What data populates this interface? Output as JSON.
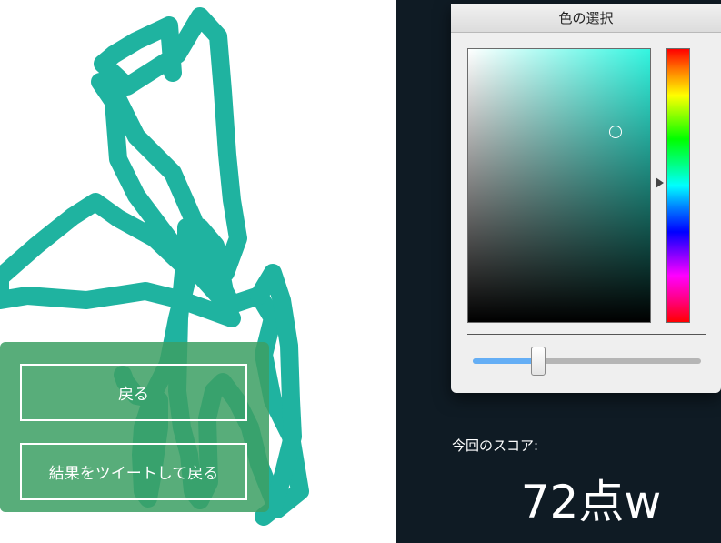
{
  "color_picker": {
    "title": "色の選択",
    "current_color": "#1fb3a0",
    "brightness_fraction": 0.28
  },
  "drawing": {
    "stroke_color": "#1fb3a0"
  },
  "result_panel": {
    "back_label": "戻る",
    "tweet_label": "結果をツイートして戻る",
    "panel_color": "#3ca064"
  },
  "score": {
    "label": "今回のスコア:",
    "value": "72点w"
  }
}
